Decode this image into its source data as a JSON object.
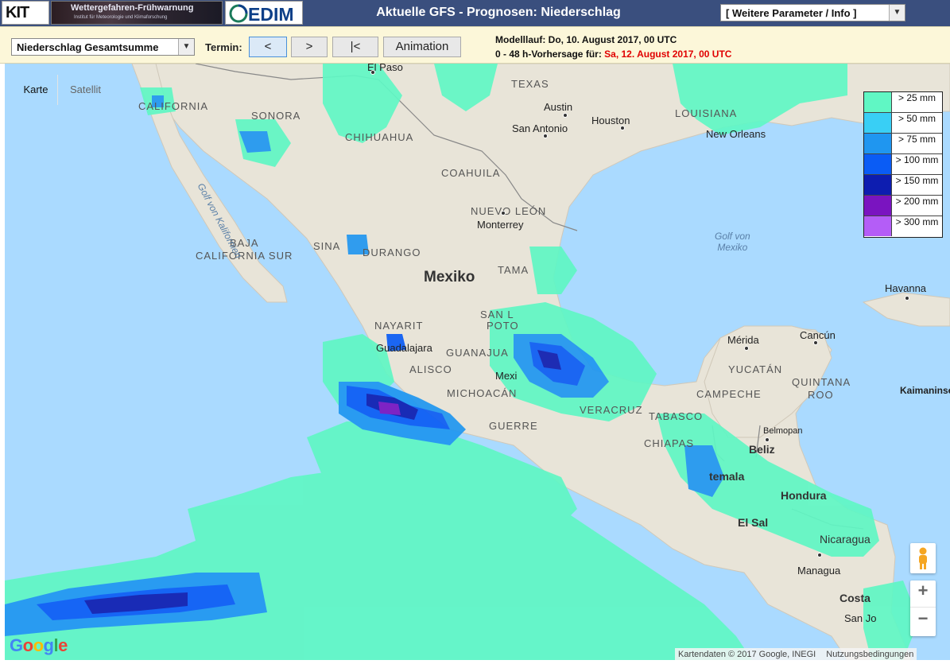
{
  "header": {
    "kit_logo_text": "KIT",
    "banner_title": "Wettergefahren-Frühwarnung",
    "banner_subtitle": "Institut für Meteorologie und Klimaforschung",
    "cedim_logo_text": "EDIM",
    "page_title": "Aktuelle GFS - Prognosen: Niederschlag",
    "param_select_value": "[ Weitere Parameter / Info ]"
  },
  "toolbar": {
    "field_select_value": "Niederschlag Gesamtsumme",
    "termin_label": "Termin:",
    "prev_label": "<",
    "next_label": ">",
    "first_label": "|<",
    "animation_label": "Animation",
    "modelrun_text": "Modelllauf: Do, 10. August 2017, 00 UTC",
    "forecast_prefix": "0 - 48 h-Vorhersage für:",
    "forecast_date": "Sa, 12. August 2017, 00 UTC",
    "forecast_date_color": "#e00000",
    "bg_color": "#fcf7d9"
  },
  "map": {
    "maptype_karte": "Karte",
    "maptype_satellit": "Satellit",
    "zoom_in_label": "+",
    "zoom_out_label": "−",
    "google_logo": "Google",
    "attribution": "Kartendaten © 2017 Google, INEGI",
    "terms": "Nutzungsbedingungen",
    "ocean_color": "#aadaff",
    "land_color": "#e8e4d8",
    "labels": {
      "country_mexiko": "Mexiko",
      "country_nicaragua": "Nicaragua",
      "country_costa": "Costa",
      "country_beliz": "Beliz",
      "country_hond": "Hondura",
      "country_temala": "temala",
      "country_elsal": "El Sal",
      "region_texas": "TEXAS",
      "region_sonora": "SONORA",
      "region_chihuahua": "CHIHUAHUA",
      "region_coahuila": "COAHUILA",
      "region_nuevoleon": "NUEVO LEÓN",
      "region_baja_cal": "BAJA",
      "region_baja_cal2": "CALIFORNIA SUR",
      "region_california": "JA\nCALIFORNIA",
      "region_sina": "SINA",
      "region_durango": "DURANGO",
      "region_tama": "TAMA",
      "region_nayarit": "NAYARIT",
      "region_guanajua": "GUANAJUA",
      "region_jalisco": "ALISCO",
      "region_sanluis": "SAN L",
      "region_potosi": "POTO",
      "region_michoacan": "MICHOACÁN",
      "region_guerrero": "GUERRE",
      "region_veracruz": "VERACRUZ",
      "region_tabasco": "TABASCO",
      "region_chiapas": "CHIAPAS",
      "region_campeche": "CAMPECHE",
      "region_yucatan": "YUCATÁN",
      "region_quintana": "QUINTANA",
      "region_roo": "ROO",
      "region_louisiana": "LOUISIANA",
      "city_elpaso": "El Paso",
      "city_austin": "Austin",
      "city_houston": "Houston",
      "city_sanantonio": "San Antonio",
      "city_neworleans": "New Orleans",
      "city_monterrey": "Monterrey",
      "city_guadalajara": "Guadalajara",
      "city_mexico": "Mexi",
      "city_merida": "Mérida",
      "city_cancun": "Cancún",
      "city_havanna": "Havanna",
      "city_belmopan": "Belmopan",
      "city_managua": "Managua",
      "city_kaimaninseln": "Kaimaninse",
      "city_sanjose": "San Jo",
      "water_golf_mexiko": "Golf von\nMexiko",
      "water_golf_kalifornien": "Golf von Kalifornien"
    }
  },
  "legend": [
    {
      "label": "> 25 mm",
      "color": "#60f7c4"
    },
    {
      "label": "> 50 mm",
      "color": "#39cff5"
    },
    {
      "label": "> 75 mm",
      "color": "#1f96f0"
    },
    {
      "label": "> 100 mm",
      "color": "#0a5cf5"
    },
    {
      "label": "> 150 mm",
      "color": "#0d1db0"
    },
    {
      "label": "> 200 mm",
      "color": "#7a14c0"
    },
    {
      "label": "> 300 mm",
      "color": "#b45df7"
    }
  ]
}
